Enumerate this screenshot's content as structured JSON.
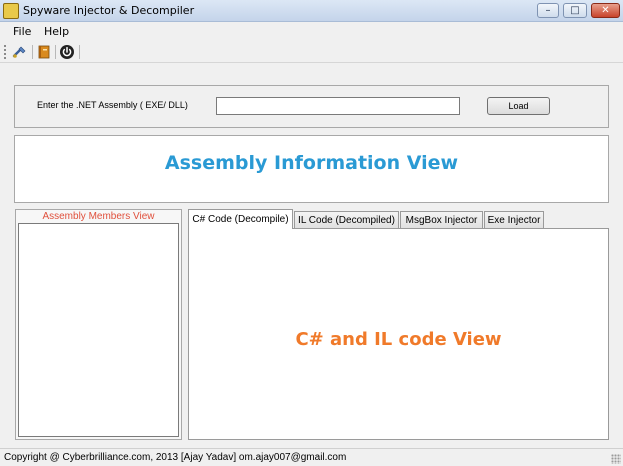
{
  "window": {
    "title": "Spyware Injector & Decompiler",
    "minimize_glyph": "–",
    "maximize_glyph": "□",
    "close_glyph": "✕"
  },
  "menu": {
    "file": "File",
    "help": "Help"
  },
  "toolbar": {
    "icons": [
      "tools-icon",
      "book-icon",
      "power-icon"
    ]
  },
  "load_panel": {
    "label": "Enter the .NET Assembly ( EXE/ DLL)",
    "input_value": "",
    "load_button": "Load"
  },
  "info_panel": {
    "caption": "Assembly Information View"
  },
  "members_panel": {
    "title": "Assembly Members View"
  },
  "tabs": [
    {
      "label": "C# Code (Decompile)",
      "active": true
    },
    {
      "label": "IL Code (Decompiled)",
      "active": false
    },
    {
      "label": "MsgBox Injector",
      "active": false
    },
    {
      "label": "Exe Injector",
      "active": false
    }
  ],
  "code_view": {
    "caption": "C# and IL code View"
  },
  "status": {
    "text": "Copyright @ Cyberbrilliance.com, 2013 [Ajay Yadav]  om.ajay007@gmail.com"
  },
  "colors": {
    "info_caption": "#2a9ad4",
    "code_caption": "#f07a2a",
    "members_title": "#e0503c"
  }
}
